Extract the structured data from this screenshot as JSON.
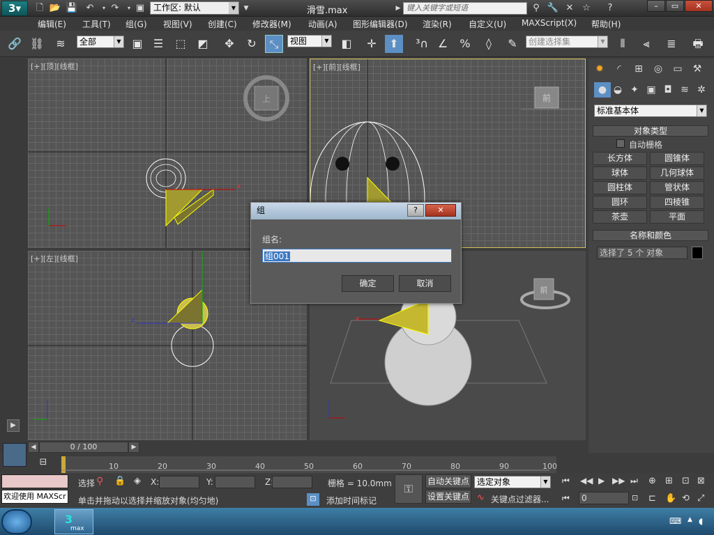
{
  "titlebar": {
    "workspace_label": "工作区: 默认",
    "filename": "滑雪.max",
    "search_placeholder": "键入关键字或短语"
  },
  "menu": [
    "编辑(E)",
    "工具(T)",
    "组(G)",
    "视图(V)",
    "创建(C)",
    "修改器(M)",
    "动画(A)",
    "图形编辑器(D)",
    "渲染(R)",
    "自定义(U)",
    "MAXScript(X)",
    "帮助(H)"
  ],
  "toolbar": {
    "filter_value": "全部",
    "refcoord_value": "视图",
    "selection_set_placeholder": "创建选择集"
  },
  "viewports": {
    "top": "[+][顶][线框]",
    "front": "[+][前][线框]",
    "left": "[+][左][线框]",
    "front_cube_label": "前",
    "top_cube_label": "上"
  },
  "command_panel": {
    "category_dropdown": "标准基本体",
    "object_type_title": "对象类型",
    "autogrid_label": "自动栅格",
    "buttons": [
      "长方体",
      "圆锥体",
      "球体",
      "几何球体",
      "圆柱体",
      "管状体",
      "圆环",
      "四棱锥",
      "茶壶",
      "平面"
    ],
    "name_color_title": "名称和颜色",
    "selection_text": "选择了 5 个 对象"
  },
  "dialog": {
    "title": "组",
    "name_label": "组名:",
    "name_value": "组001",
    "ok": "确定",
    "cancel": "取消"
  },
  "timeline": {
    "frame_label": "0 / 100",
    "ticks": [
      "10",
      "20",
      "30",
      "40",
      "50",
      "60",
      "70",
      "80",
      "90",
      "100"
    ]
  },
  "statusbar": {
    "welcome": "欢迎使用 MAXScr",
    "select_label": "选择",
    "x_label": "X:",
    "y_label": "Y:",
    "z_label": "Z:",
    "grid": "栅格 = 10.0mm",
    "prompt": "单击并拖动以选择并缩放对象(均匀地)",
    "add_time_tag": "添加时间标记",
    "auto_key": "自动关键点",
    "set_key": "设置关键点",
    "key_mode_value": "选定对象",
    "key_filters": "关键点过滤器...",
    "frame_value": "0"
  },
  "taskbar": {
    "app_label": "max"
  }
}
